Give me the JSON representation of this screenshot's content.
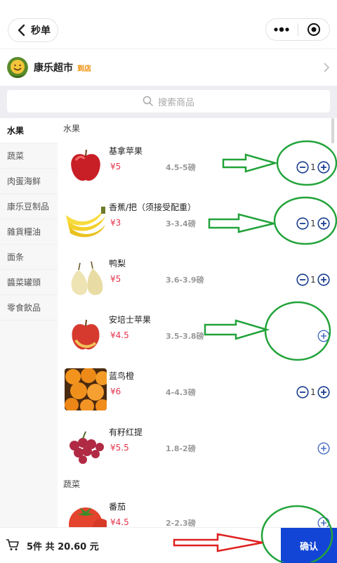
{
  "header": {
    "title": "秒单",
    "back_icon": "chevron-left-icon",
    "more_icon": "more-dots-icon",
    "close_icon": "target-circle-icon"
  },
  "store": {
    "name": "康乐超市",
    "tag": "到店"
  },
  "search": {
    "placeholder": "搜索商品"
  },
  "sidebar": {
    "categories": [
      "水果",
      "蔬菜",
      "肉蛋海鲜",
      "康乐豆制品",
      "雜貨糧油",
      "面条",
      "醬菜罐頭",
      "零食飲品"
    ]
  },
  "sections": [
    {
      "title": "水果",
      "items": [
        {
          "name": "基拿苹果",
          "price": "¥5",
          "spec": "4.5-5磅",
          "qty": "1"
        },
        {
          "name": "香蕉/把（须接受配重）",
          "price": "¥3",
          "spec": "3-3.4磅",
          "qty": "1"
        },
        {
          "name": "鸭梨",
          "price": "¥5",
          "spec": "3.6-3.9磅",
          "qty": "1"
        },
        {
          "name": "安培士苹果",
          "price": "¥4.5",
          "spec": "3.5-3.8磅",
          "qty": ""
        },
        {
          "name": "蓝鸟橙",
          "price": "¥6",
          "spec": "4-4.3磅",
          "qty": "1"
        },
        {
          "name": "有籽红提",
          "price": "¥5.5",
          "spec": "1.8-2磅",
          "qty": ""
        }
      ]
    },
    {
      "title": "蔬菜",
      "items": [
        {
          "name": "番茄",
          "price": "¥4.5",
          "spec": "2-2.3磅",
          "qty": ""
        }
      ]
    }
  ],
  "bottom": {
    "summary": "5件 共 20.60 元",
    "confirm_label": "确认"
  },
  "colors": {
    "accent": "#1245d6",
    "price": "#e5344c",
    "tag": "#f08a00",
    "annotation_green": "#22a33a",
    "annotation_red": "#e02020"
  }
}
